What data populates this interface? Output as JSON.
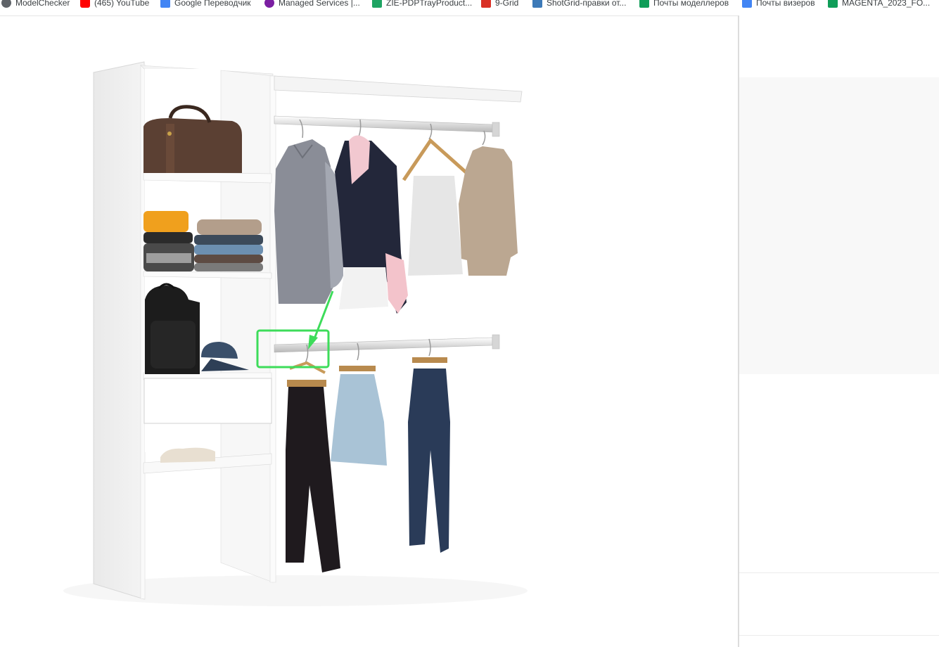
{
  "bookmarks": [
    {
      "label": "ModelChecker",
      "icon": "globe-icon",
      "color": "#5f6368"
    },
    {
      "label": "(465) YouTube",
      "icon": "youtube-icon",
      "color": "#ff0000"
    },
    {
      "label": "Google Переводчик",
      "icon": "translate-icon",
      "color": "#4285f4"
    },
    {
      "label": "Managed Services |...",
      "icon": "managed-services-icon",
      "color": "#7b1fa2"
    },
    {
      "label": "ZIE-PDPTrayProduct...",
      "icon": "google-drive-icon",
      "color": "#1fa463"
    },
    {
      "label": "9-Grid",
      "icon": "pdf-icon",
      "color": "#d93025"
    },
    {
      "label": "ShotGrid-правки от...",
      "icon": "shotgrid-icon",
      "color": "#3d7ab8"
    },
    {
      "label": "Почты моделлеров",
      "icon": "google-sheets-icon",
      "color": "#0f9d58"
    },
    {
      "label": "Почты визеров",
      "icon": "google-docs-icon",
      "color": "#4285f4"
    },
    {
      "label": "MAGENTA_2023_FO...",
      "icon": "google-sheets-icon",
      "color": "#0f9d58"
    }
  ],
  "annotation": {
    "color": "#3ddc5a"
  },
  "colors": {
    "background": "#ffffff",
    "panel_grey": "#f8f8f8"
  }
}
